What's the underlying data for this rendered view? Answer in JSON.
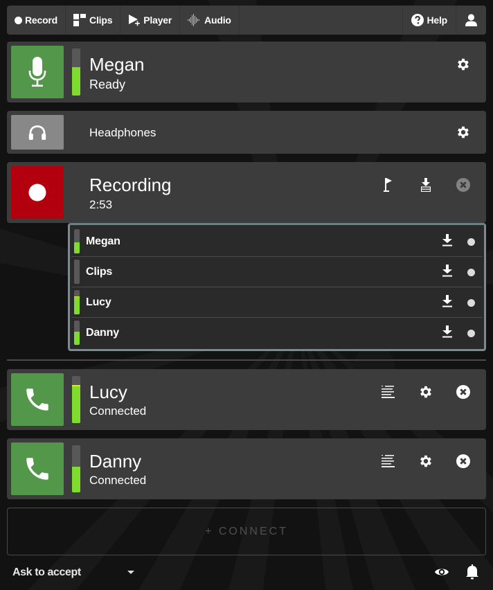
{
  "toolbar": {
    "items": [
      {
        "label": "Record",
        "icon": "dot-icon"
      },
      {
        "label": "Clips",
        "icon": "clips-grid-icon"
      },
      {
        "label": "Player",
        "icon": "play-plus-icon"
      },
      {
        "label": "Audio",
        "icon": "waveform-icon"
      }
    ],
    "help_label": "Help",
    "help_icon": "question-circle-icon",
    "user_icon": "user-icon"
  },
  "local_mic": {
    "name": "Megan",
    "status": "Ready",
    "icon": "microphone-icon",
    "tile_color": "#53974b",
    "level": 0.6,
    "settings_icon": "gear-icon"
  },
  "headphones": {
    "label": "Headphones",
    "icon": "headphones-icon",
    "tile_color": "#888888",
    "settings_icon": "gear-icon"
  },
  "recording": {
    "title": "Recording",
    "elapsed": "2:53",
    "tile_color": "#b3000f",
    "icon": "record-dot-icon",
    "actions": [
      "flag-icon",
      "download-all-icon",
      "close-circle-icon"
    ]
  },
  "tracks": [
    {
      "name": "Megan",
      "level": 0.45,
      "peak": null
    },
    {
      "name": "Clips",
      "level": 0.0,
      "peak": null
    },
    {
      "name": "Lucy",
      "level": 0.72,
      "peak": 0.72
    },
    {
      "name": "Danny",
      "level": 0.55,
      "peak": null
    }
  ],
  "callers": [
    {
      "name": "Lucy",
      "status": "Connected",
      "icon": "phone-icon",
      "tile_color": "#53974b",
      "level": 0.78,
      "peak": 0.78,
      "actions": [
        "notes-list-icon",
        "gear-icon",
        "close-circle-icon"
      ]
    },
    {
      "name": "Danny",
      "status": "Connected",
      "icon": "phone-icon",
      "tile_color": "#53974b",
      "level": 0.54,
      "peak": null,
      "actions": [
        "notes-list-icon",
        "gear-icon",
        "close-circle-icon"
      ]
    }
  ],
  "connect": {
    "label": "+ CONNECT"
  },
  "footer": {
    "accept_mode": "Ask to accept",
    "icons": [
      "eye-icon",
      "bell-icon"
    ]
  },
  "colors": {
    "accent_green": "#7ddc2e",
    "peak_yellow": "#e4e41a",
    "card_bg": "#3c3c3c",
    "page_bg": "#121212"
  }
}
